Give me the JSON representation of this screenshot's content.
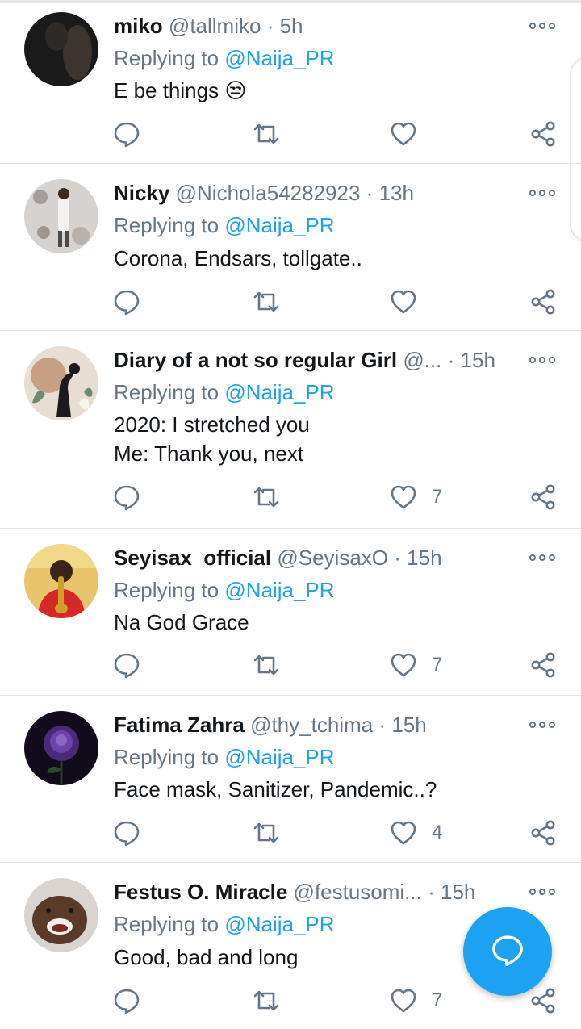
{
  "reply_prefix": "Replying to",
  "replying_to": "@Naija_PR",
  "tweets": [
    {
      "name": "miko",
      "handle": "@tallmiko",
      "time": "5h",
      "text": "E be things 😒",
      "likes": ""
    },
    {
      "name": "Nicky",
      "handle": "@Nichola54282923",
      "time": "13h",
      "text": "Corona, Endsars, tollgate..",
      "likes": ""
    },
    {
      "name": "Diary of a not so regular Girl",
      "handle": "@...",
      "time": "15h",
      "text": "2020: I stretched you\nMe: Thank you, next",
      "likes": "7"
    },
    {
      "name": "Seyisax_official",
      "handle": "@SeyisaxO",
      "time": "15h",
      "text": "Na God Grace",
      "likes": "7"
    },
    {
      "name": "Fatima Zahra",
      "handle": "@thy_tchima",
      "time": "15h",
      "text": "Face mask, Sanitizer, Pandemic..?",
      "likes": "4"
    },
    {
      "name": "Festus O. Miracle",
      "handle": "@festusomi...",
      "time": "15h",
      "text": "Good, bad and long",
      "likes": "7"
    }
  ],
  "separator": "·",
  "icons": [
    "reply-icon",
    "retweet-icon",
    "like-icon",
    "share-icon",
    "more-icon",
    "compose-reply-icon"
  ],
  "colors": {
    "accent": "#1da1f2",
    "muted": "#657786",
    "text": "#14171a",
    "divider": "#e1e8ed"
  }
}
